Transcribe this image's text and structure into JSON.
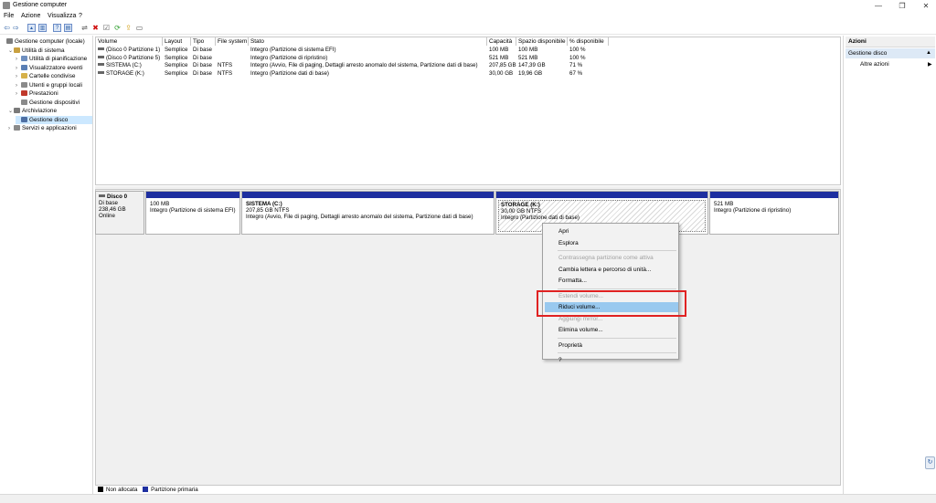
{
  "window": {
    "title": "Gestione computer",
    "minimize": "—",
    "maximize": "❐",
    "close": "✕"
  },
  "menu": [
    "File",
    "Azione",
    "Visualizza",
    "?"
  ],
  "toolbar": {
    "back": "⇦",
    "forward": "⇨",
    "up": "▲",
    "show_hide": "▥",
    "help": "?",
    "list": "▤",
    "connect": "⇌",
    "delete": "✖",
    "properties": "☑",
    "refresh": "⟳",
    "export": "⇪",
    "new": "▭",
    "colors": {
      "delete": "#d01010",
      "refresh": "#2a9d2a",
      "export": "#d4a017"
    }
  },
  "tree": [
    {
      "label": "Gestione computer (locale)",
      "exp": "",
      "icon": "computer-icon",
      "color": "#7d7d7d",
      "indent": 0,
      "selected": false
    },
    {
      "label": "Utilità di sistema",
      "exp": "⌄",
      "icon": "tools-icon",
      "color": "#c8a040",
      "indent": 1,
      "selected": false
    },
    {
      "label": "Utilità di pianificazione",
      "exp": "›",
      "icon": "clock-icon",
      "color": "#6e8fbf",
      "indent": 2,
      "selected": false
    },
    {
      "label": "Visualizzatore eventi",
      "exp": "›",
      "icon": "event-viewer-icon",
      "color": "#5a7fb5",
      "indent": 2,
      "selected": false
    },
    {
      "label": "Cartelle condivise",
      "exp": "›",
      "icon": "shared-folder-icon",
      "color": "#d6b14a",
      "indent": 2,
      "selected": false
    },
    {
      "label": "Utenti e gruppi locali",
      "exp": "›",
      "icon": "users-icon",
      "color": "#8a8a8a",
      "indent": 2,
      "selected": false
    },
    {
      "label": "Prestazioni",
      "exp": "›",
      "icon": "performance-icon",
      "color": "#c0392b",
      "indent": 2,
      "selected": false
    },
    {
      "label": "Gestione dispositivi",
      "exp": "",
      "icon": "device-manager-icon",
      "color": "#8a8a8a",
      "indent": 2,
      "selected": false
    },
    {
      "label": "Archiviazione",
      "exp": "⌄",
      "icon": "storage-icon",
      "color": "#7a7a7a",
      "indent": 1,
      "selected": false
    },
    {
      "label": "Gestione disco",
      "exp": "",
      "icon": "disk-management-icon",
      "color": "#4d6fa3",
      "indent": 2,
      "selected": true
    },
    {
      "label": "Servizi e applicazioni",
      "exp": "›",
      "icon": "services-icon",
      "color": "#8a8a8a",
      "indent": 1,
      "selected": false
    }
  ],
  "volumes": {
    "columns": [
      "Volume",
      "Layout",
      "Tipo",
      "File system",
      "Stato",
      "Capacità",
      "Spazio disponibile",
      "% disponibile"
    ],
    "rows": [
      [
        "(Disco 0 Partizione 1)",
        "Semplice",
        "Di base",
        "",
        "Integro (Partizione di sistema EFI)",
        "100 MB",
        "100 MB",
        "100 %"
      ],
      [
        "(Disco 0 Partizione 5)",
        "Semplice",
        "Di base",
        "",
        "Integro (Partizione di ripristino)",
        "521 MB",
        "521 MB",
        "100 %"
      ],
      [
        "SISTEMA (C:)",
        "Semplice",
        "Di base",
        "NTFS",
        "Integro (Avvio, File di paging, Dettagli arresto anomalo del sistema, Partizione dati di base)",
        "207,85 GB",
        "147,39 GB",
        "71 %"
      ],
      [
        "STORAGE (K:)",
        "Semplice",
        "Di base",
        "NTFS",
        "Integro (Partizione dati di base)",
        "30,00 GB",
        "19,96 GB",
        "67 %"
      ]
    ]
  },
  "disk": {
    "name": "Disco 0",
    "type": "Di base",
    "size": "238,46 GB",
    "status": "Online",
    "partitions": [
      {
        "name": "",
        "size": "100 MB",
        "status": "Integro (Partizione di sistema EFI)",
        "hatched": false
      },
      {
        "name": "SISTEMA  (C:)",
        "size": "207,85 GB NTFS",
        "status": "Integro (Avvio, File di paging, Dettagli arresto anomalo del sistema, Partizione dati di base)",
        "hatched": false
      },
      {
        "name": "STORAGE  (K:)",
        "size": "30,00 GB NTFS",
        "status": "Integro (Partizione dati di base)",
        "hatched": true
      },
      {
        "name": "",
        "size": "521 MB",
        "status": "Integro (Partizione di ripristino)",
        "hatched": false
      }
    ]
  },
  "context_menu": [
    {
      "label": "Apri",
      "disabled": false
    },
    {
      "label": "Esplora",
      "disabled": false
    },
    {
      "sep": true
    },
    {
      "label": "Contrassegna partizione come attiva",
      "disabled": true
    },
    {
      "label": "Cambia lettera e percorso di unità...",
      "disabled": false
    },
    {
      "label": "Formatta...",
      "disabled": false
    },
    {
      "sep": true
    },
    {
      "label": "Estendi volume...",
      "disabled": true
    },
    {
      "label": "Riduci volume...",
      "disabled": false,
      "highlighted": true
    },
    {
      "label": "Aggiungi mirror...",
      "disabled": true
    },
    {
      "label": "Elimina volume...",
      "disabled": false
    },
    {
      "sep": true
    },
    {
      "label": "Proprietà",
      "disabled": false
    },
    {
      "sep": true
    },
    {
      "label": "?",
      "disabled": false
    }
  ],
  "legend": [
    {
      "label": "Non allocata",
      "color": "#000000"
    },
    {
      "label": "Partizione primaria",
      "color": "#1e2fa0"
    }
  ],
  "actions": {
    "header": "Azioni",
    "selected": "Gestione disco",
    "more": "Altre azioni",
    "collapse_arrow": "▲",
    "more_arrow": "▶"
  },
  "corner_icon": "↻"
}
